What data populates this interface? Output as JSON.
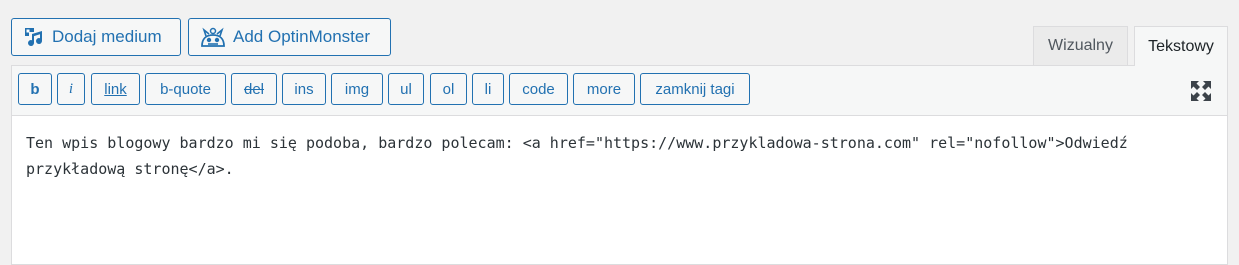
{
  "media_buttons": {
    "add_media": {
      "label": "Dodaj medium",
      "icon": "media-icon"
    },
    "add_optinmonster": {
      "label": "Add OptinMonster",
      "icon": "optinmonster-icon"
    }
  },
  "tabs": [
    {
      "label": "Wizualny",
      "active": false
    },
    {
      "label": "Tekstowy",
      "active": true
    }
  ],
  "quicktags": [
    "b",
    "i",
    "link",
    "b-quote",
    "del",
    "ins",
    "img",
    "ul",
    "ol",
    "li",
    "code",
    "more",
    "zamknij tagi"
  ],
  "fullscreen_icon": "fullscreen-icon",
  "content": {
    "line1": "Ten wpis blogowy bardzo mi się podoba, bardzo polecam: <a href=\"https://www.przykladowa-strona.com\" rel=\"nofollow\">Odwiedź",
    "line2": "przykładową stronę</a>."
  },
  "colors": {
    "accent": "#2271b1",
    "text": "#2c3338",
    "border": "#dcdcde"
  }
}
